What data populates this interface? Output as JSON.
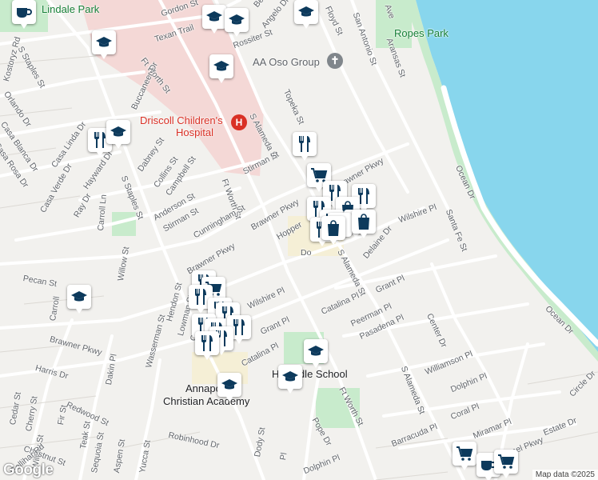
{
  "map": {
    "colors": {
      "water": "#88d6ed",
      "park": "#c8ebcc",
      "hospital": "#f4d8d6",
      "road": "#ffffff",
      "land": "#f2f1ee",
      "marker": "#0d3a5c"
    },
    "attribution": "Map data ©2025",
    "logo": "Google",
    "places": {
      "lindale_park": "Lindale Park",
      "ropes_park": "Ropes Park",
      "aa_oso": "AA Oso Group",
      "hospital_line1": "Driscoll Children's",
      "hospital_line2": "Hospital",
      "middle_school": "H        Middle School",
      "annapolis_line1": "Annapo",
      "annapolis_line2": "Christian Academy"
    },
    "streets": {
      "gordon": "Gordon St",
      "texan_trail": "Texan Trail",
      "beve": "Beve",
      "angelo": "Angelo Dr",
      "floyd": "Floyd St",
      "san_antonio": "San Antonio St",
      "aransas": "Aransas St",
      "ave": "Ave",
      "rossiter": "Rossiter St",
      "kostoryz": "Kostoryz Rd",
      "s_staples_top": "S Staples St",
      "fort_worth_top": "Ft Worth St",
      "buccaneer": "Buccaneer Dr",
      "orlando": "Orlando Dr",
      "topeka": "Topeka St",
      "s_alameda_top": "S Alameda St",
      "casa_blanca": "Casa Blanca Dr",
      "casa_rosa": "Casa Rosa Dr",
      "casa_linda": "Casa Linda Dr",
      "casa_verde": "Casa Verde Dr",
      "hayward": "Hayward Dr",
      "dabney": "Dabney St",
      "collins": "Collins St",
      "campbell": "Campbell St",
      "s_staples_mid": "S Staples St",
      "carroll_ln": "Carroll Ln",
      "ray": "Ray Dr",
      "anderson": "Anderson St",
      "stirman_w": "Stirman St",
      "stirman_e": "Stirman St",
      "fort_worth_mid": "Ft Worth St",
      "cunningham": "Cunningham St",
      "brawner_mid": "Brawner Pkwy",
      "brawner_ne": "rawner Pkwy",
      "brawner_w": "Brawner Pkwy",
      "hopper": "Hopper",
      "do": "Do",
      "ocean_n": "Ocean Dr",
      "ocean_s": "Ocean Dr",
      "wilshire_e": "Wilshire Pl",
      "santa_fe": "Santa Fe St",
      "delaine": "Delaine Dr",
      "s_alameda_mid": "S Alameda St",
      "grant_e": "Grant Pl",
      "pecan": "Pecan St",
      "willow_mid": "Willow St",
      "carroll_mid": "Carroll",
      "hendon": "Hendon St",
      "lowman": "Lowman St",
      "wilshire_w": "Wilshire Pl",
      "catalina_e": "Catalina Pl",
      "center": "Center Dr",
      "cott": "Cott",
      "brawner_sw": "Brawner Pkwy",
      "wasserman": "Wasserman St",
      "grant_w": "Grant Pl",
      "peerman": "Peerman Pl",
      "pasadena": "Pasadena Pl",
      "catalina_w": "Catalina Pl",
      "harris": "Harris Dr",
      "dakin": "Dakin Pl",
      "williamson": "Williamson Pl",
      "dolphin_e": "Dolphin Pl",
      "s_alameda_s": "S Alameda St",
      "circle": "Circle Dr",
      "cedar": "Cedar St",
      "cherry": "Cherry St",
      "fir": "Fir St",
      "redwood": "Redwood St",
      "fort_worth_s": "Ft Worth St",
      "willow_s": "Willow St",
      "chestnut": "Chestnut St",
      "teak": "Teak St",
      "sequoia": "Sequoia St",
      "aspen": "Aspen St",
      "yucca": "Yucca St",
      "robinhood": "Robinhood Dr",
      "dody": "Dody St",
      "pope": "Pope Dr",
      "barracuda": "Barracuda Pl",
      "coral": "Coral Pl",
      "miramar": "Miramar Pl",
      "estate": "Estate Dr",
      "carmel": "rmel Pkwy",
      "gollihar": "Gollihar Rd",
      "dolphin_s": "Dolphin Pl",
      "pl": "Pl",
      "n_d": "nd"
    },
    "marker_icons": {
      "coffee": "coffee-cup-icon",
      "school": "graduation-cap-icon",
      "restaurant": "fork-knife-icon",
      "shopping": "shopping-bag-icon",
      "grocery": "shopping-cart-icon",
      "place_of_worship": "cross-icon",
      "hospital": "hospital-h-icon"
    }
  }
}
